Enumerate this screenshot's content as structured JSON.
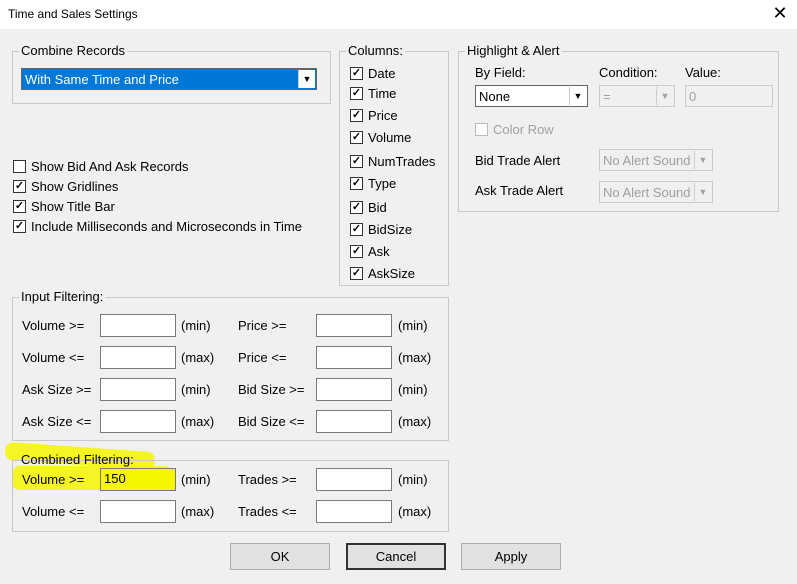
{
  "window": {
    "title": "Time and Sales Settings",
    "close": "✕"
  },
  "combine": {
    "legend": "Combine Records",
    "selected": "With Same Time and Price"
  },
  "options": [
    {
      "label": "Show Bid And Ask Records",
      "checked": false
    },
    {
      "label": "Show Gridlines",
      "checked": true
    },
    {
      "label": "Show Title Bar",
      "checked": true
    },
    {
      "label": "Include Milliseconds and Microseconds in Time",
      "checked": true
    }
  ],
  "columns": {
    "legend": "Columns:",
    "items": [
      "Date",
      "Time",
      "Price",
      "Volume",
      "NumTrades",
      "Type",
      "Bid",
      "BidSize",
      "Ask",
      "AskSize"
    ]
  },
  "highlight": {
    "legend": "Highlight & Alert",
    "by_field_label": "By Field:",
    "condition_label": "Condition:",
    "value_label": "Value:",
    "by_field": "None",
    "condition": "=",
    "value": "0",
    "color_row": "Color Row",
    "bid_alert_label": "Bid Trade Alert",
    "ask_alert_label": "Ask Trade Alert",
    "bid_alert": "No Alert Sound",
    "ask_alert": "No Alert Sound"
  },
  "input_filtering": {
    "legend": "Input Filtering:",
    "rows": [
      {
        "l1": "Volume >=",
        "u1": "(min)",
        "l2": "Price >=",
        "u2": "(min)",
        "v1": "",
        "v2": ""
      },
      {
        "l1": "Volume <=",
        "u1": "(max)",
        "l2": "Price <=",
        "u2": "(max)",
        "v1": "",
        "v2": ""
      },
      {
        "l1": "Ask Size >=",
        "u1": "(min)",
        "l2": "Bid Size >=",
        "u2": "(min)",
        "v1": "",
        "v2": ""
      },
      {
        "l1": "Ask Size <=",
        "u1": "(max)",
        "l2": "Bid Size <=",
        "u2": "(max)",
        "v1": "",
        "v2": ""
      }
    ]
  },
  "combined_filtering": {
    "legend": "Combined Filtering:",
    "rows": [
      {
        "l1": "Volume >=",
        "u1": "(min)",
        "l2": "Trades >=",
        "u2": "(min)",
        "v1": "150",
        "v2": ""
      },
      {
        "l1": "Volume <=",
        "u1": "(max)",
        "l2": "Trades <=",
        "u2": "(max)",
        "v1": "",
        "v2": ""
      }
    ]
  },
  "buttons": {
    "ok": "OK",
    "cancel": "Cancel",
    "apply": "Apply"
  },
  "colors": {
    "highlight": "#f6f600",
    "selection": "#0078d7"
  }
}
